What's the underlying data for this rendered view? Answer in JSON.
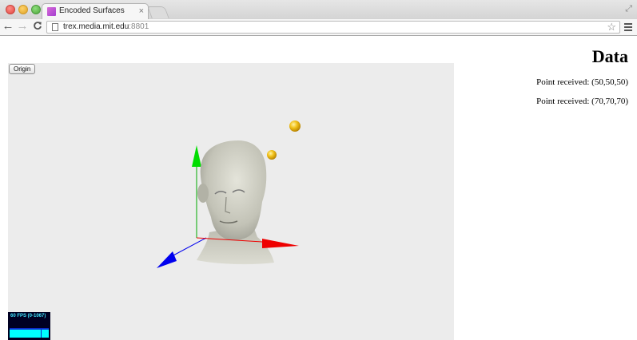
{
  "browser": {
    "tab": {
      "title": "Encoded Surfaces",
      "close_glyph": "×"
    },
    "address": {
      "host": "trex.media.mit.edu",
      "port": ":8801"
    },
    "icons": {
      "back": "arrow-left-icon",
      "forward": "arrow-right-icon",
      "reload": "reload-icon",
      "page": "page-icon",
      "star": "star-icon",
      "menu": "hamburger-menu-icon",
      "fullscreen": "fullscreen-icon"
    },
    "glyphs": {
      "back": "←",
      "forward": "→",
      "reload": "C",
      "star": "☆",
      "fullscreen": "⤢"
    }
  },
  "page": {
    "origin_button": "Origin",
    "fps": {
      "label": "60 FPS (0-1067)"
    },
    "scene": {
      "objects": [
        "x-axis-arrow",
        "y-axis-arrow",
        "z-axis-arrow",
        "head-model",
        "point-sphere",
        "point-sphere"
      ],
      "colors": {
        "x_axis": "#ff0000",
        "y_axis": "#00cc00",
        "z_axis": "#0000ff",
        "sphere": "#f2c21a",
        "head": "#c9c9bd",
        "background": "#ececec"
      }
    },
    "data_panel": {
      "heading": "Data",
      "points": [
        "Point received: (50,50,50)",
        "Point received: (70,70,70)"
      ]
    }
  }
}
